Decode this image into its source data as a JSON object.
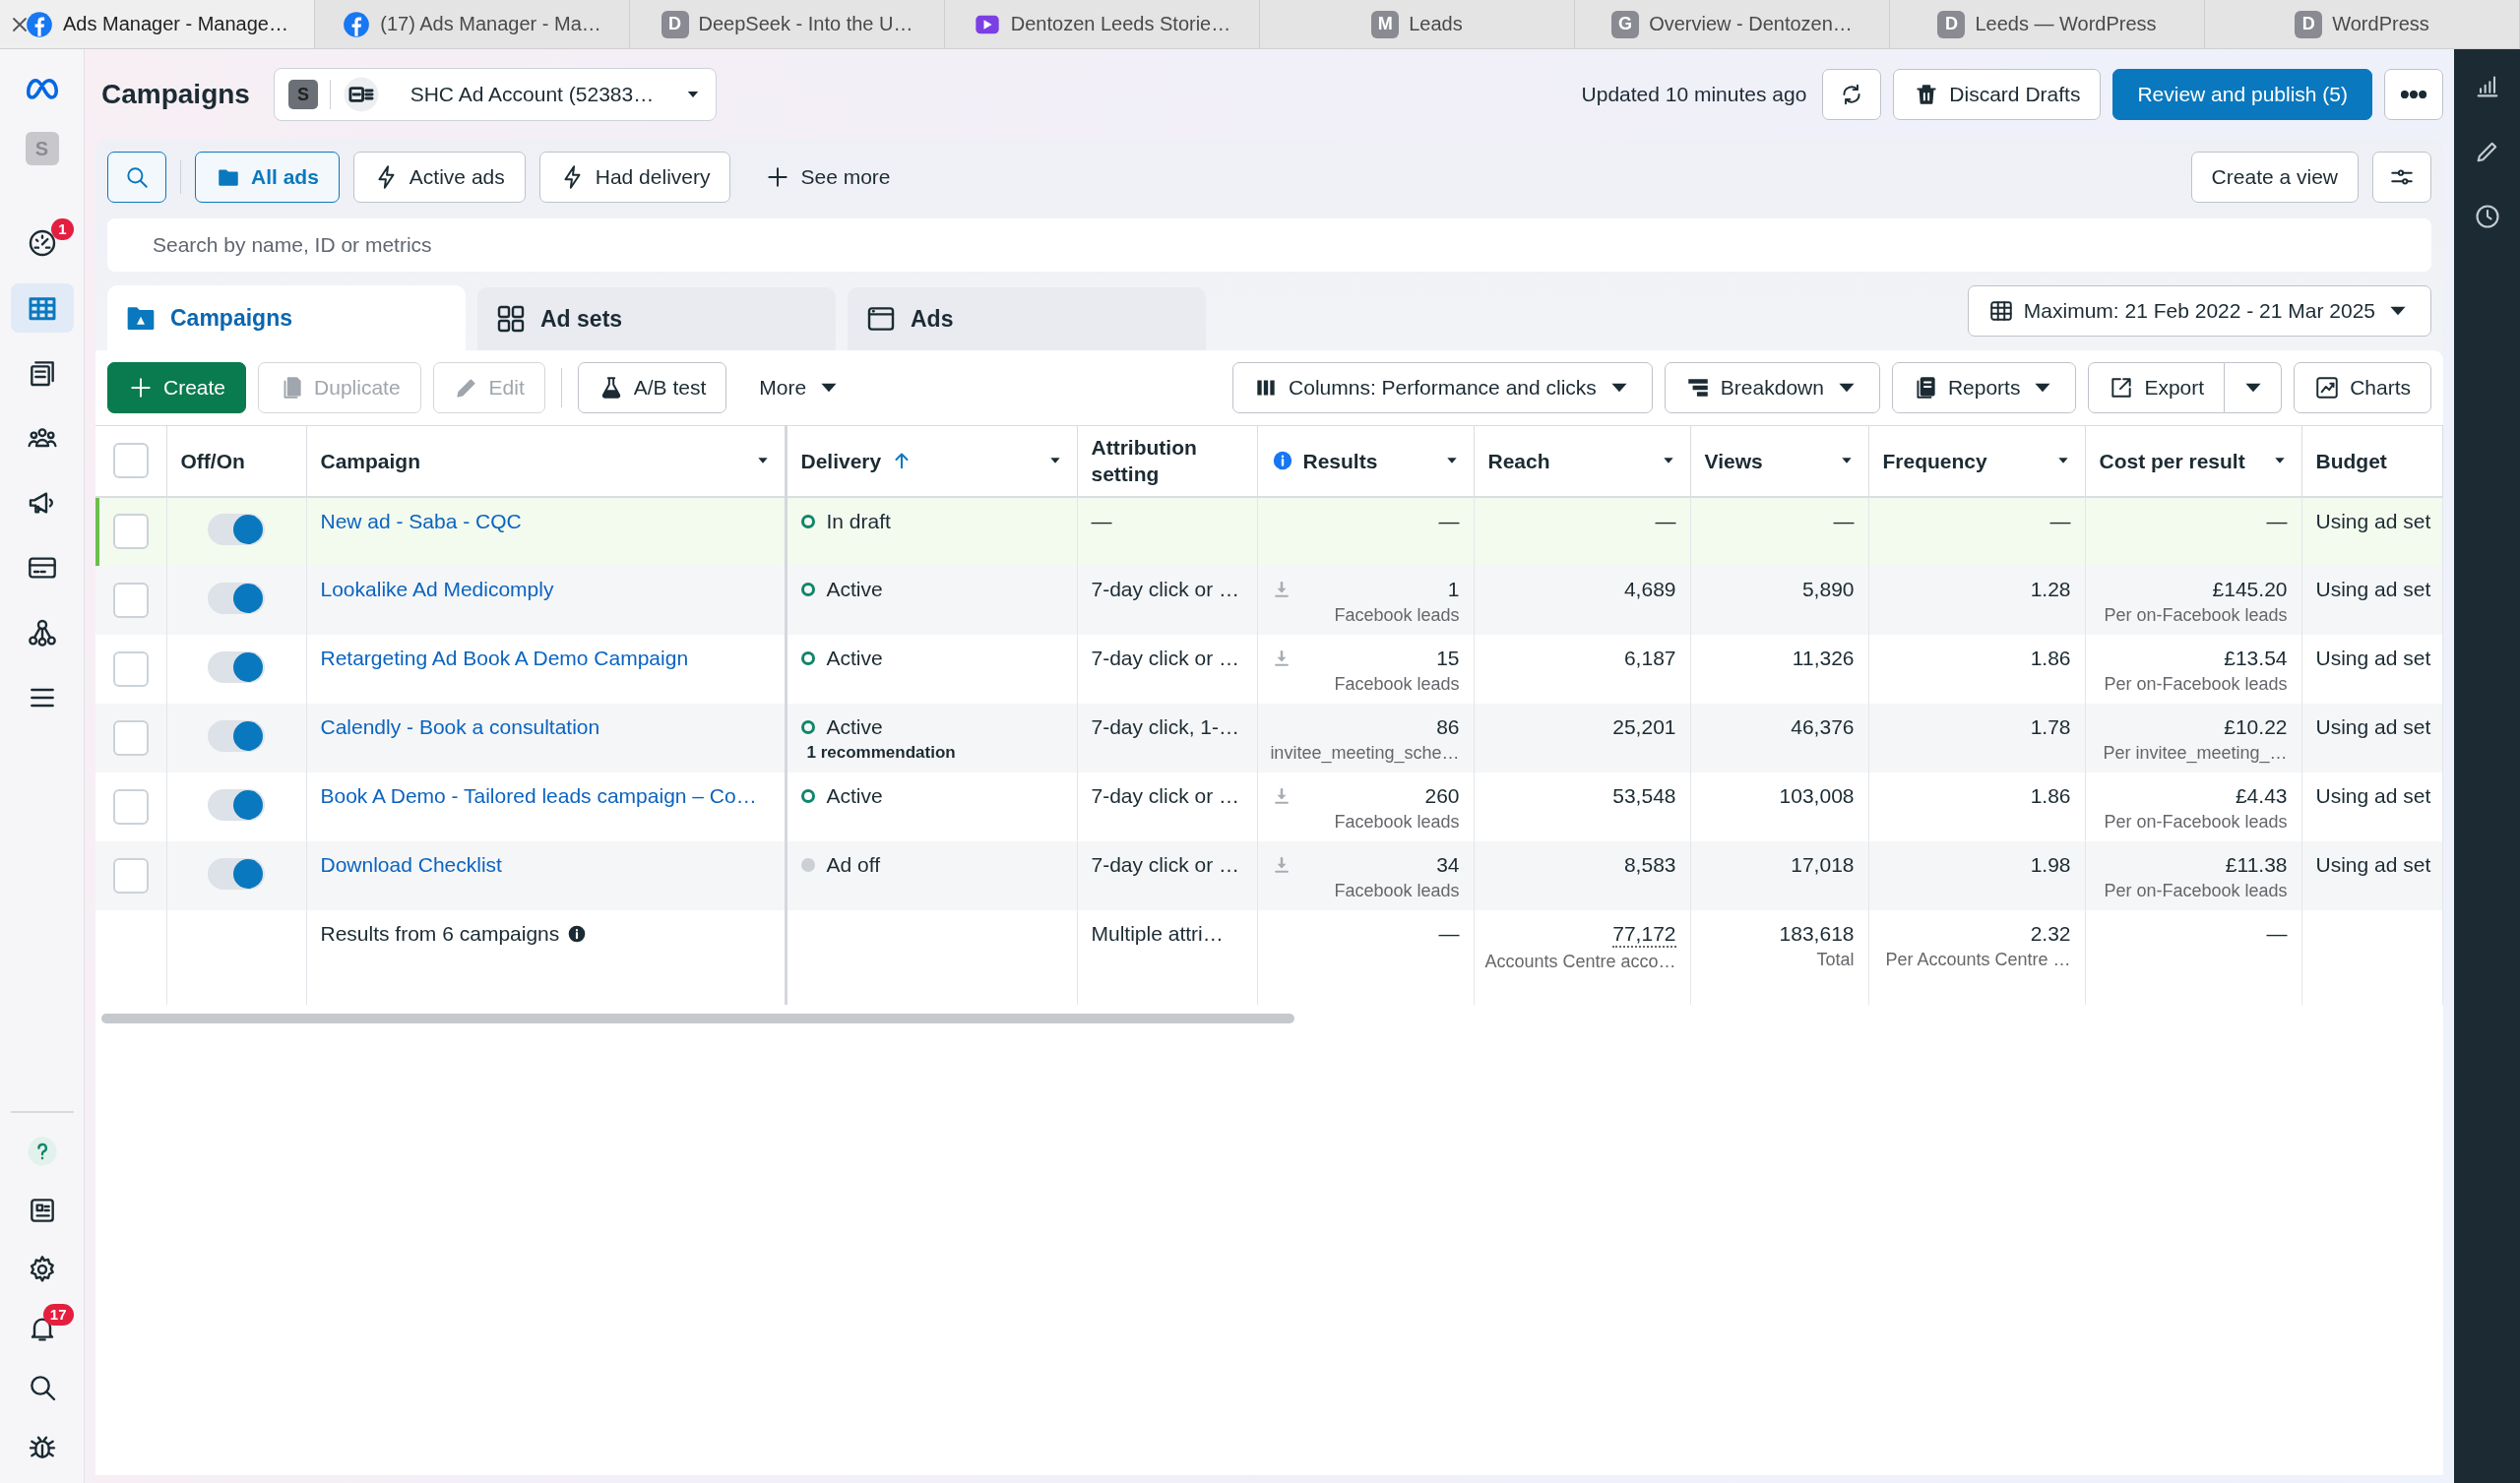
{
  "browser_tabs": [
    {
      "title": "Ads Manager - Manage…",
      "kind": "facebook",
      "selected": true
    },
    {
      "title": "(17) Ads Manager - Ma…",
      "kind": "facebook",
      "selected": false
    },
    {
      "title": "DeepSeek - Into the U…",
      "kind": "letter",
      "letter": "D",
      "selected": false
    },
    {
      "title": "Dentozen Leeds Storie…",
      "kind": "video",
      "selected": false
    },
    {
      "title": "Leads",
      "kind": "letter",
      "letter": "M",
      "selected": false
    },
    {
      "title": "Overview - Dentozen…",
      "kind": "letter",
      "letter": "G",
      "selected": false
    },
    {
      "title": "Leeds — WordPress",
      "kind": "letter",
      "letter": "D",
      "selected": false
    },
    {
      "title": "WordPress",
      "kind": "letter",
      "letter": "D",
      "selected": false
    }
  ],
  "sidebar": {
    "account_avatar": "S",
    "top_items": [
      {
        "badge": "1",
        "selected": false
      },
      {
        "selected": true
      },
      {
        "selected": false
      },
      {
        "selected": false
      },
      {
        "selected": false
      },
      {
        "selected": false
      },
      {
        "selected": false
      },
      {
        "selected": false
      }
    ],
    "bottom_items": [
      {
        "selected": false
      },
      {
        "selected": false
      },
      {
        "selected": false
      },
      {
        "badge": "17",
        "selected": false
      },
      {
        "selected": false
      },
      {
        "selected": false
      }
    ]
  },
  "header": {
    "title": "Campaigns",
    "account": {
      "avatar": "S",
      "name": "SHC Ad Account (52383…"
    },
    "updated": "Updated 10 minutes ago",
    "discard": "Discard Drafts",
    "publish": "Review and publish (5)"
  },
  "filters": [
    {
      "label": "All ads",
      "selected": true
    },
    {
      "label": "Active ads",
      "selected": false
    },
    {
      "label": "Had delivery",
      "selected": false
    }
  ],
  "see_more": "See more",
  "create_view": "Create a view",
  "search": {
    "placeholder": "Search by name, ID or metrics"
  },
  "level_tabs": [
    {
      "label": "Campaigns",
      "selected": true
    },
    {
      "label": "Ad sets",
      "selected": false
    },
    {
      "label": "Ads",
      "selected": false
    }
  ],
  "date_range": "Maximum: 21 Feb 2022 - 21 Mar 2025",
  "toolbar": {
    "create": {
      "label": "Create"
    },
    "duplicate": {
      "label": "Duplicate",
      "disabled": true
    },
    "edit": {
      "label": "Edit",
      "disabled": true
    },
    "ab_test": {
      "label": "A/B test"
    },
    "more": {
      "label": "More"
    },
    "columns": {
      "label": "Columns: Performance and clicks"
    },
    "breakdown": {
      "label": "Breakdown"
    },
    "reports": {
      "label": "Reports"
    },
    "export": {
      "label": "Export"
    },
    "charts": {
      "label": "Charts"
    }
  },
  "table": {
    "select_all": {
      "checked": false
    },
    "columns": [
      {
        "label": "Off/On"
      },
      {
        "label": "Campaign",
        "menu": true
      },
      {
        "label": "Delivery",
        "menu": true,
        "sorted_ascending": true
      },
      {
        "label": "Attribution setting"
      },
      {
        "label": "Results",
        "menu": true,
        "info": true
      },
      {
        "label": "Reach",
        "menu": true
      },
      {
        "label": "Views",
        "menu": true
      },
      {
        "label": "Frequency",
        "menu": true
      },
      {
        "label": "Cost per result",
        "menu": true
      },
      {
        "label": "Budget"
      }
    ],
    "rows": [
      {
        "checked": false,
        "on": true,
        "highlighted": true,
        "campaign": "New ad - Saba - CQC",
        "delivery": {
          "status": "In draft",
          "kind": "draft"
        },
        "attribution": "—",
        "results": {
          "value": "—"
        },
        "reach": "—",
        "views": "—",
        "frequency": "—",
        "cost": {
          "value": "—"
        },
        "budget": "Using ad set"
      },
      {
        "checked": false,
        "on": true,
        "highlighted": false,
        "campaign": "Lookalike Ad Medicomply",
        "delivery": {
          "status": "Active",
          "kind": "active"
        },
        "attribution": "7-day click or …",
        "results": {
          "value": "1",
          "note": "Facebook leads",
          "download": true
        },
        "reach": "4,689",
        "views": "5,890",
        "frequency": "1.28",
        "cost": {
          "value": "£145.20",
          "note": "Per on-Facebook leads"
        },
        "budget": "Using ad set"
      },
      {
        "checked": false,
        "on": true,
        "highlighted": false,
        "campaign": "Retargeting Ad Book A Demo Campaign",
        "delivery": {
          "status": "Active",
          "kind": "active"
        },
        "attribution": "7-day click or …",
        "results": {
          "value": "15",
          "note": "Facebook leads",
          "download": true
        },
        "reach": "6,187",
        "views": "11,326",
        "frequency": "1.86",
        "cost": {
          "value": "£13.54",
          "note": "Per on-Facebook leads"
        },
        "budget": "Using ad set"
      },
      {
        "checked": false,
        "on": true,
        "highlighted": false,
        "campaign": "Calendly - Book a consultation",
        "delivery": {
          "status": "Active",
          "kind": "active",
          "note": "1 recommendation"
        },
        "attribution": "7-day click, 1-…",
        "results": {
          "value": "86",
          "note": "invitee_meeting_sche…",
          "download": false
        },
        "reach": "25,201",
        "views": "46,376",
        "frequency": "1.78",
        "cost": {
          "value": "£10.22",
          "note": "Per invitee_meeting_…"
        },
        "budget": "Using ad set"
      },
      {
        "checked": false,
        "on": true,
        "highlighted": false,
        "campaign": "Book A Demo - Tailored leads campaign – Co…",
        "delivery": {
          "status": "Active",
          "kind": "active"
        },
        "attribution": "7-day click or …",
        "results": {
          "value": "260",
          "note": "Facebook leads",
          "download": true
        },
        "reach": "53,548",
        "views": "103,008",
        "frequency": "1.86",
        "cost": {
          "value": "£4.43",
          "note": "Per on-Facebook leads"
        },
        "budget": "Using ad set"
      },
      {
        "checked": false,
        "on": true,
        "highlighted": false,
        "campaign": "Download Checklist",
        "delivery": {
          "status": "Ad off",
          "kind": "off"
        },
        "attribution": "7-day click or …",
        "results": {
          "value": "34",
          "note": "Facebook leads",
          "download": true
        },
        "reach": "8,583",
        "views": "17,018",
        "frequency": "1.98",
        "cost": {
          "value": "£11.38",
          "note": "Per on-Facebook leads"
        },
        "budget": "Using ad set"
      }
    ],
    "summary": {
      "label": "Results from 6 campaigns",
      "attribution": "Multiple attri…",
      "results": "—",
      "reach": {
        "value": "77,172",
        "note": "Accounts Centre acco…"
      },
      "views": {
        "value": "183,618",
        "note": "Total"
      },
      "frequency": {
        "value": "2.32",
        "note": "Per Accounts Centre …"
      },
      "cost": "—"
    }
  }
}
